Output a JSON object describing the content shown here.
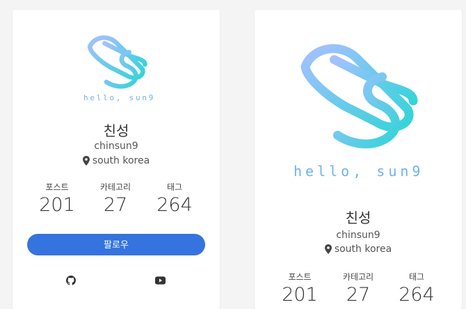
{
  "profile": {
    "logo_text": "hello, sun9",
    "name": "친성",
    "username": "chinsun9",
    "location": "south korea"
  },
  "stats": [
    {
      "label": "포스트",
      "value": "201"
    },
    {
      "label": "카테고리",
      "value": "27"
    },
    {
      "label": "태그",
      "value": "264"
    }
  ],
  "follow_button": {
    "label": "팔로우"
  },
  "social": [
    "github-icon",
    "youtube-icon"
  ],
  "colors": {
    "accent": "#3574de",
    "logo_gradient_start": "#a3c4ff",
    "logo_gradient_end": "#36d6d6"
  }
}
